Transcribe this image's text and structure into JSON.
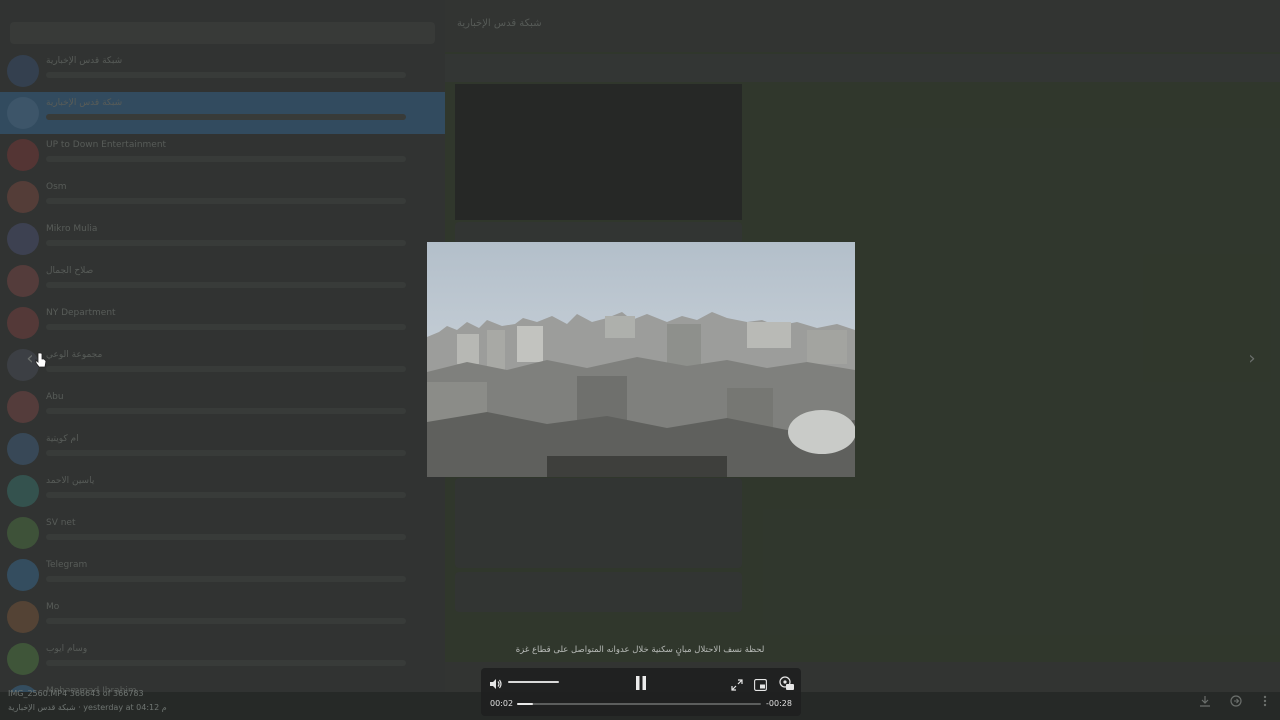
{
  "background_app": {
    "chat_title": "شبكة قدس الإخبارية",
    "chats": [
      {
        "title": "شبكة قدس الإخبارية",
        "avatar_color": "#3f4e63",
        "active": false
      },
      {
        "title": "شبكة قدس الإخبارية",
        "avatar_color": "#4b6a86",
        "active": true
      },
      {
        "title": "UP to Down Entertainment",
        "avatar_color": "#6a3f3f",
        "active": false
      },
      {
        "title": "Osm",
        "avatar_color": "#6a4a45",
        "active": false
      },
      {
        "title": "Mikro Mulia",
        "avatar_color": "#4b4f66",
        "active": false
      },
      {
        "title": "صلاح الجمال",
        "avatar_color": "#6a4848",
        "active": false
      },
      {
        "title": "NY Department",
        "avatar_color": "#6a4545",
        "active": false
      },
      {
        "title": "مجموعة الوعي",
        "avatar_color": "#4a4d55",
        "active": false
      },
      {
        "title": "Abu",
        "avatar_color": "#6a4848",
        "active": false
      },
      {
        "title": "ام كويتية",
        "avatar_color": "#44596e",
        "active": false
      },
      {
        "title": "ياسين الأحمد",
        "avatar_color": "#3f6662",
        "active": false
      },
      {
        "title": "SV net",
        "avatar_color": "#4c6646",
        "active": false
      },
      {
        "title": "Telegram",
        "avatar_color": "#3f5f78",
        "active": false
      },
      {
        "title": "Mo",
        "avatar_color": "#6a5240",
        "active": false
      },
      {
        "title": "وسام أيوب",
        "avatar_color": "#4e6a46",
        "active": false
      },
      {
        "title": "Mohammad Ibrahim",
        "avatar_color": "#3f5f78",
        "active": false
      }
    ]
  },
  "viewer": {
    "prev_arrow": "‹",
    "next_arrow": "›",
    "caption": "لحظة نسف الاحتلال مبانٍ سكنية خلال عدوانه المتواصل على قطاع غزة",
    "file_name_info": "IMG_2560.MP4 366643 of 366783",
    "sender_time": "شبكة قدس الإخبارية · yesterday at 04:12 م",
    "controls": {
      "time_current": "00:02",
      "time_remaining": "-00:28",
      "progress_fraction": 0.065,
      "volume_fraction": 1.0,
      "speed_badge": "1x"
    }
  },
  "colors": {
    "sky_top": "#b6c2cd",
    "sky_bottom": "#d9dfe3",
    "rubble": "#8e8f8c",
    "accent_active_chat": "#3c5d78"
  }
}
